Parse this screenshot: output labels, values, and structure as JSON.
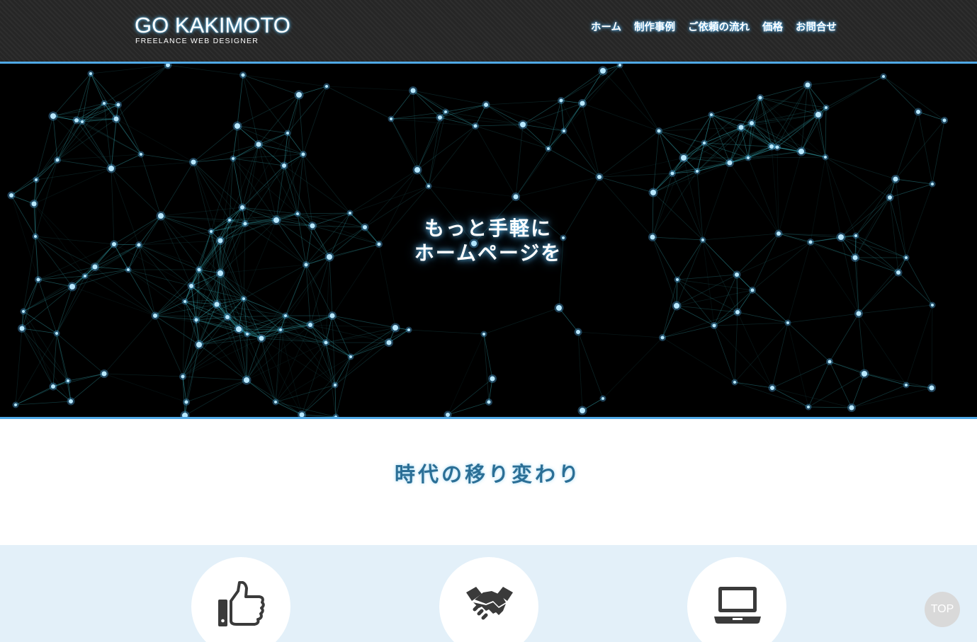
{
  "header": {
    "logo_title": "GO KAKIMOTO",
    "logo_subtitle": "FREELANCE WEB DESIGNER",
    "nav": [
      {
        "label": "ホーム"
      },
      {
        "label": "制作事例"
      },
      {
        "label": "ご依頼の流れ"
      },
      {
        "label": "価格"
      },
      {
        "label": "お問合せ"
      }
    ]
  },
  "hero": {
    "line1": "もっと手軽に",
    "line2": "ホームページを"
  },
  "section": {
    "title": "時代の移り変わり"
  },
  "features": [
    {
      "icon": "thumbs-up-icon"
    },
    {
      "icon": "handshake-icon"
    },
    {
      "icon": "laptop-icon"
    }
  ],
  "top_button": {
    "label": "TOP"
  },
  "colors": {
    "accent": "#4fa9e6",
    "header_bg": "#262626",
    "hero_bg": "#000000",
    "node": "#b8e8ff",
    "section_title": "#2b6f96",
    "features_bg": "#e3f0f9"
  }
}
